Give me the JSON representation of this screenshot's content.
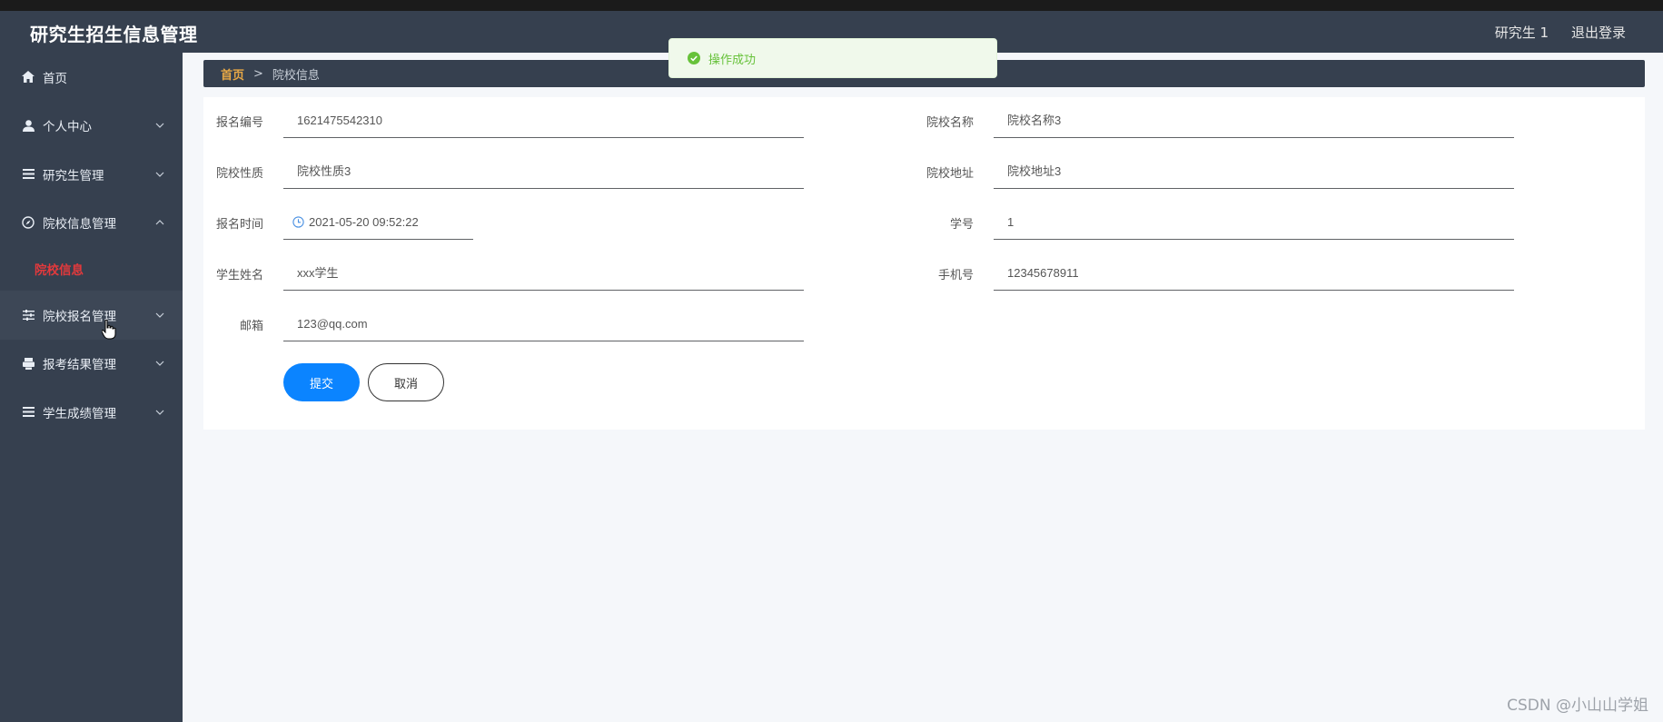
{
  "app": {
    "title": "研究生招生信息管理"
  },
  "header": {
    "user_name": "研究生 1",
    "logout_label": "退出登录"
  },
  "sidebar": {
    "items": [
      {
        "label": "首页",
        "icon": "home-icon"
      },
      {
        "label": "个人中心",
        "icon": "user-icon"
      },
      {
        "label": "研究生管理",
        "icon": "list-icon"
      },
      {
        "label": "院校信息管理",
        "icon": "compass-icon",
        "expanded": true,
        "children": [
          {
            "label": "院校信息",
            "active": true
          }
        ]
      },
      {
        "label": "院校报名管理",
        "icon": "sliders-icon"
      },
      {
        "label": "报考结果管理",
        "icon": "printer-icon"
      },
      {
        "label": "学生成绩管理",
        "icon": "list-icon"
      }
    ]
  },
  "breadcrumb": {
    "home": "首页",
    "separator": ">",
    "current": "院校信息"
  },
  "form": {
    "fields": {
      "registration_no": {
        "label": "报名编号",
        "value": "1621475542310"
      },
      "school_name": {
        "label": "院校名称",
        "value": "院校名称3"
      },
      "school_type": {
        "label": "院校性质",
        "value": "院校性质3"
      },
      "school_address": {
        "label": "院校地址",
        "value": "院校地址3"
      },
      "registration_time": {
        "label": "报名时间",
        "value": "2021-05-20 09:52:22"
      },
      "student_id": {
        "label": "学号",
        "value": "1"
      },
      "student_name": {
        "label": "学生姓名",
        "value": "xxx学生"
      },
      "phone": {
        "label": "手机号",
        "value": "12345678911"
      },
      "email": {
        "label": "邮箱",
        "value": "123@qq.com"
      }
    },
    "submit_label": "提交",
    "cancel_label": "取消"
  },
  "toast": {
    "message": "操作成功",
    "type": "success"
  },
  "watermark": "CSDN @小山山学姐",
  "colors": {
    "sidebar_bg": "#36404f",
    "accent_blue": "#0b84ff",
    "active_menu": "#e4393c",
    "breadcrumb_home": "#e8a845",
    "success_green": "#67c23a"
  }
}
